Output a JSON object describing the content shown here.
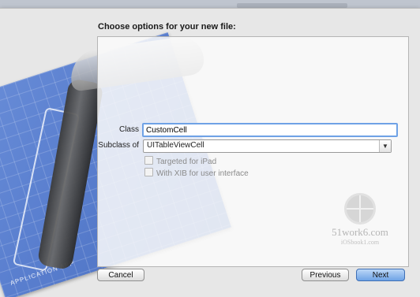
{
  "dialog": {
    "title": "Choose options for your new file:",
    "form": {
      "class_label": "Class",
      "class_value": "CustomCell",
      "subclass_label": "Subclass of",
      "subclass_value": "UITableViewCell",
      "checkboxes": [
        {
          "label": "Targeted for iPad",
          "checked": false,
          "enabled": false
        },
        {
          "label": "With XIB for user interface",
          "checked": false,
          "enabled": false
        }
      ]
    },
    "buttons": {
      "cancel": "Cancel",
      "previous": "Previous",
      "next": "Next"
    }
  },
  "artwork": {
    "blueprint_caption": "APPLICATION APP"
  },
  "watermark": {
    "line1": "51work6.com",
    "line2": "iOSbook1.com"
  },
  "colors": {
    "focus_ring": "#6fa2e6",
    "primary_button": "#6ea3e6",
    "blueprint": "#5a7fcf"
  }
}
